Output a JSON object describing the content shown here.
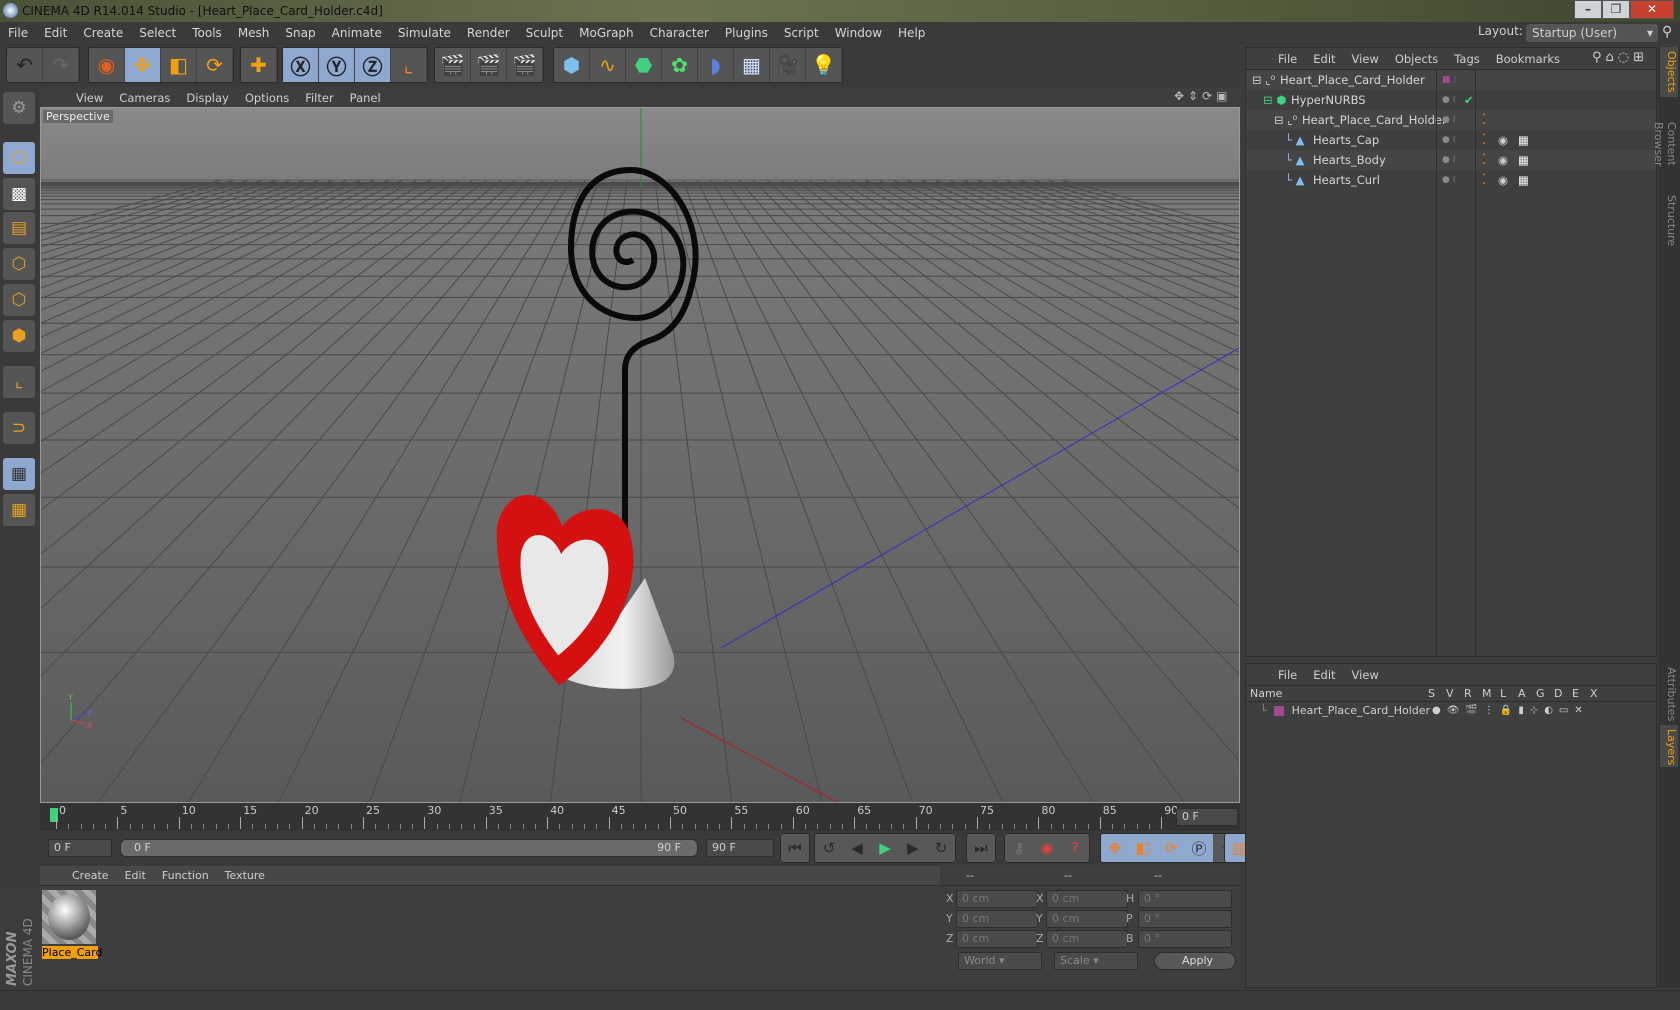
{
  "window": {
    "title": "CINEMA 4D R14.014 Studio - [Heart_Place_Card_Holder.c4d]",
    "controls": [
      "minimize",
      "restore",
      "close"
    ]
  },
  "menu": [
    "File",
    "Edit",
    "Create",
    "Select",
    "Tools",
    "Mesh",
    "Snap",
    "Animate",
    "Simulate",
    "Render",
    "Sculpt",
    "MoGraph",
    "Character",
    "Plugins",
    "Script",
    "Window",
    "Help"
  ],
  "layout": {
    "label": "Layout:",
    "value": "Startup (User)"
  },
  "toolbar_icons": [
    "undo-icon",
    "redo-icon",
    "live-selection-icon",
    "move-icon",
    "scale-icon",
    "rotate-icon",
    "add-icon",
    "x-axis-icon",
    "y-axis-icon",
    "z-axis-icon",
    "coordinate-system-icon",
    "render-view-icon",
    "render-picture-viewer-icon",
    "edit-render-settings-icon",
    "cube-icon",
    "spline-pen-icon",
    "nurbs-icon",
    "array-icon",
    "deformer-icon",
    "floor-icon",
    "camera-icon",
    "light-icon"
  ],
  "viewport": {
    "menu": [
      "View",
      "Cameras",
      "Display",
      "Options",
      "Filter",
      "Panel"
    ],
    "label": "Perspective"
  },
  "timeline": {
    "ticks": [
      "0",
      "5",
      "10",
      "15",
      "20",
      "25",
      "30",
      "35",
      "40",
      "45",
      "50",
      "55",
      "60",
      "65",
      "70",
      "75",
      "80",
      "85",
      "90"
    ],
    "current_frame": "0 F",
    "start": "0 F",
    "range_start": "0 F",
    "range_end": "90 F",
    "end": "90 F"
  },
  "materials": {
    "menu": [
      "Create",
      "Edit",
      "Function",
      "Texture"
    ],
    "items": [
      {
        "name": "Place_Card"
      }
    ]
  },
  "coordinates": {
    "headers": [
      "--",
      "--",
      "--"
    ],
    "rows": [
      {
        "a": "X",
        "av": "0 cm",
        "b": "X",
        "bv": "0 cm",
        "c": "H",
        "cv": "0 °"
      },
      {
        "a": "Y",
        "av": "0 cm",
        "b": "Y",
        "bv": "0 cm",
        "c": "P",
        "cv": "0 °"
      },
      {
        "a": "Z",
        "av": "0 cm",
        "b": "Z",
        "bv": "0 cm",
        "c": "B",
        "cv": "0 °"
      }
    ],
    "world": "World",
    "scale": "Scale",
    "apply": "Apply"
  },
  "objects": {
    "menu": [
      "File",
      "Edit",
      "View",
      "Objects",
      "Tags",
      "Bookmarks"
    ],
    "items": [
      {
        "name": "Heart_Place_Card_Holder",
        "depth": 0,
        "icon": "null-icon"
      },
      {
        "name": "HyperNURBS",
        "depth": 1,
        "icon": "hypernurbs-icon"
      },
      {
        "name": "Heart_Place_Card_Holder",
        "depth": 2,
        "icon": "null-icon"
      },
      {
        "name": "Hearts_Cap",
        "depth": 3,
        "icon": "polygon-icon"
      },
      {
        "name": "Hearts_Body",
        "depth": 3,
        "icon": "polygon-icon"
      },
      {
        "name": "Hearts_Curl",
        "depth": 3,
        "icon": "polygon-icon"
      }
    ]
  },
  "layers": {
    "menu": [
      "File",
      "Edit",
      "View"
    ],
    "columns": [
      "Name",
      "S",
      "V",
      "R",
      "M",
      "L",
      "A",
      "G",
      "D",
      "E",
      "X"
    ],
    "items": [
      {
        "name": "Heart_Place_Card_Holder",
        "color": "#a04a8c"
      }
    ]
  },
  "side_tabs": [
    "Objects",
    "Content Browser",
    "Structure",
    "Attributes",
    "Layers"
  ],
  "brand": {
    "maxon": "MAXON",
    "product": "CINEMA 4D"
  },
  "colors": {
    "accent": "#e8a020",
    "selection": "#8fa8cf",
    "heart_red": "#d01010",
    "play": "#3ed27a",
    "layer": "#a04a8c"
  }
}
